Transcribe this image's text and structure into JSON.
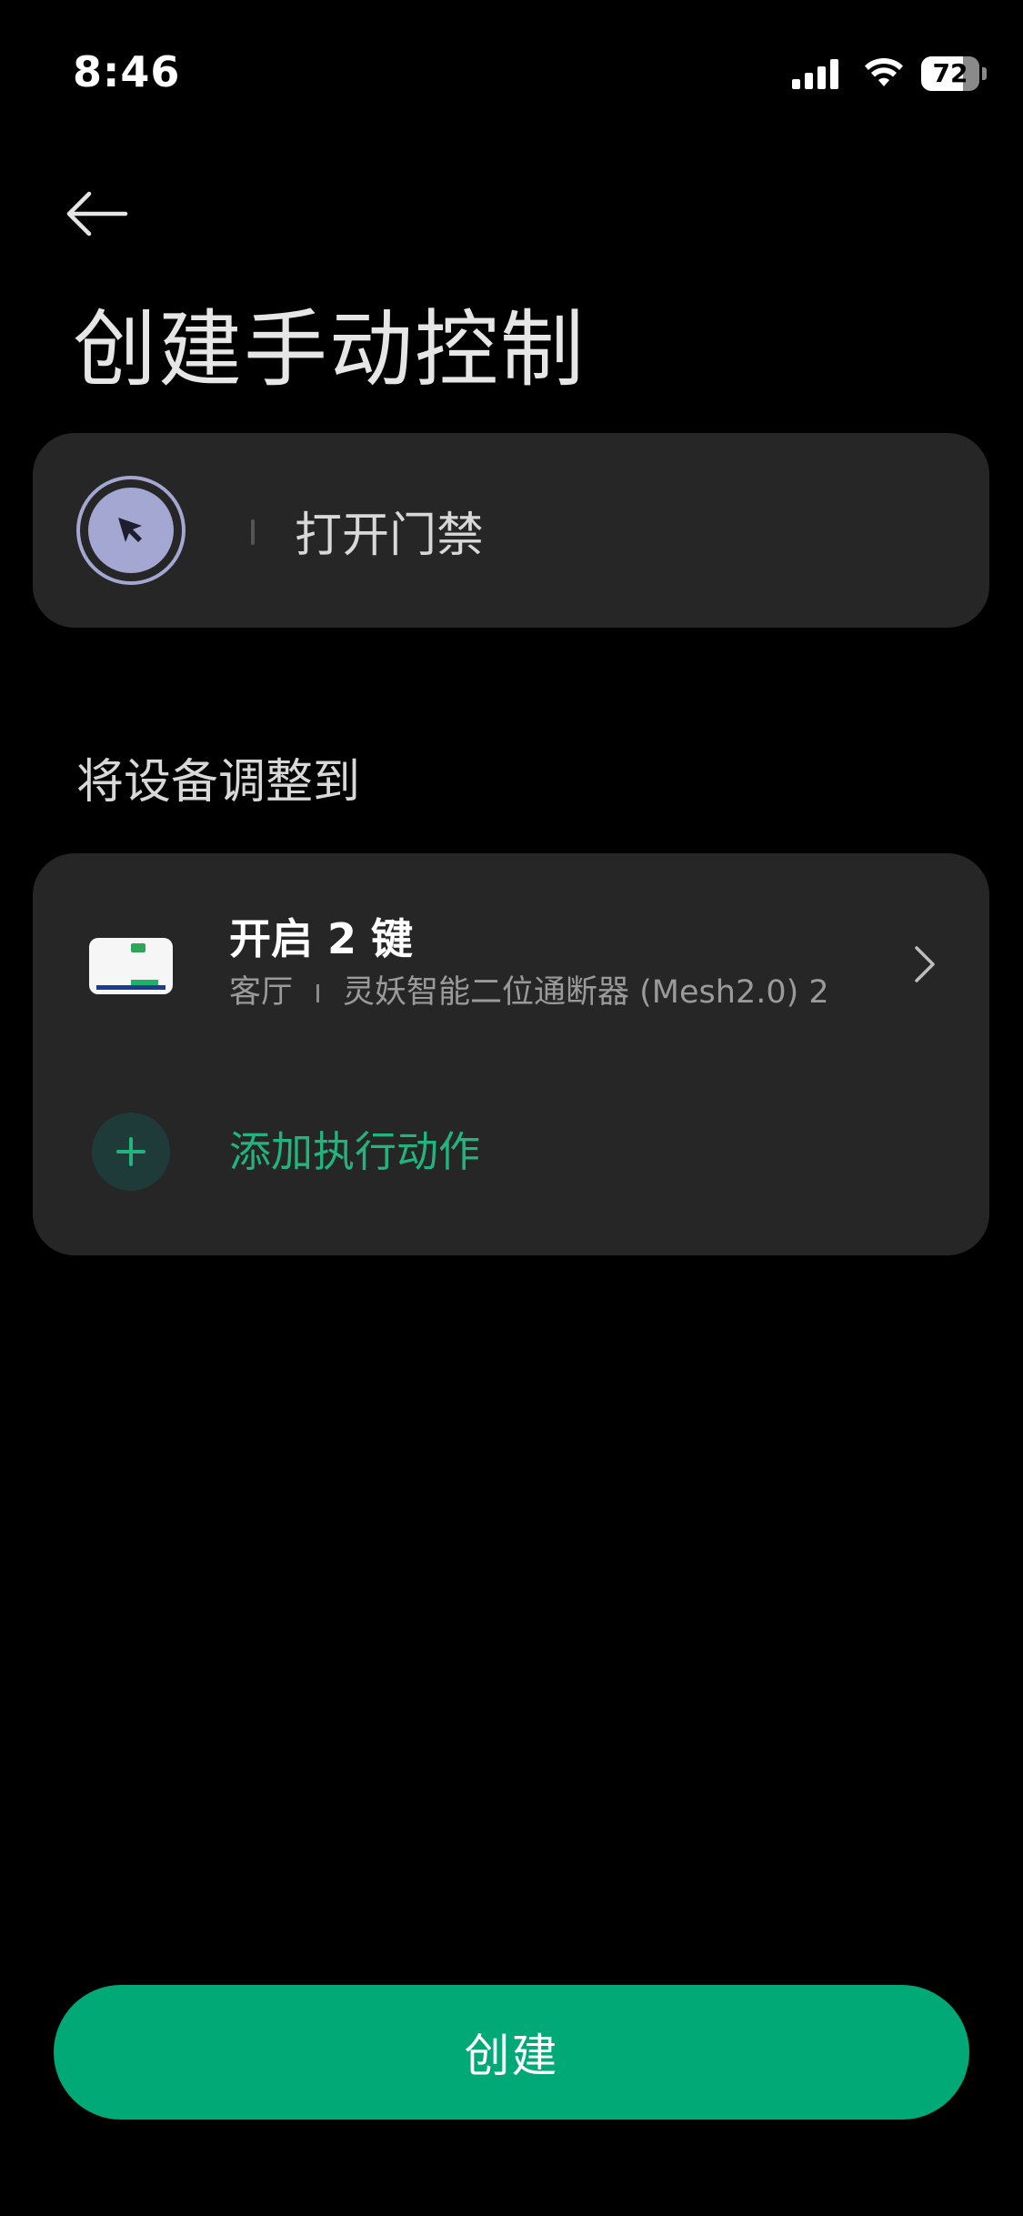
{
  "status_bar": {
    "time": "8:46",
    "battery_level": "72",
    "battery_fraction": 0.72
  },
  "header": {
    "back_icon": "arrow-left-icon",
    "title": "创建手动控制"
  },
  "scene": {
    "icon": "cursor-click-icon",
    "icon_color": "#a3a7d2",
    "name_value": "打开门禁"
  },
  "section": {
    "label": "将设备调整到"
  },
  "actions": [
    {
      "title": "开启 2 键",
      "room": "客厅",
      "device": "灵妖智能二位通断器 (Mesh2.0) 2"
    }
  ],
  "add_action": {
    "icon": "plus-icon",
    "label": "添加执行动作"
  },
  "footer": {
    "create_label": "创建"
  },
  "colors": {
    "background": "#000000",
    "card": "#262626",
    "accent": "#00a975",
    "accent_text": "#22b37e"
  }
}
